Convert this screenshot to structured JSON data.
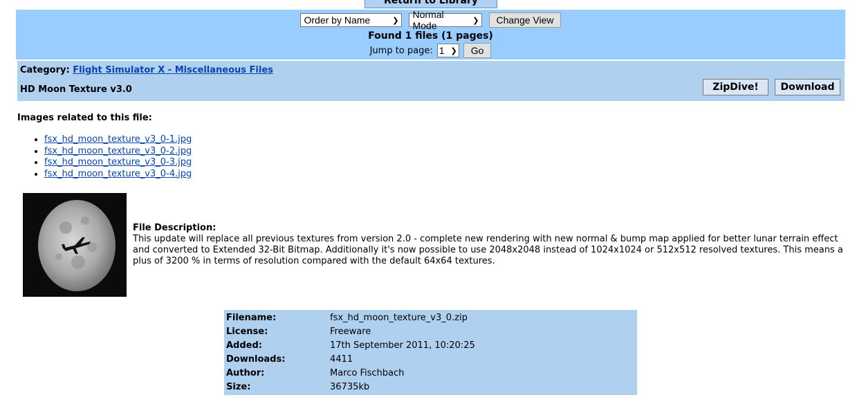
{
  "nav": {
    "return_label": "Return to Library"
  },
  "controls": {
    "order_select": "Order by Name",
    "mode_select": "Normal Mode",
    "change_view_label": "Change View",
    "found_text": "Found 1 files (1 pages)",
    "jump_label": "Jump to page:",
    "page_select": "1",
    "go_label": "Go"
  },
  "category": {
    "label": "Category:",
    "link_text": "Flight Simulator X - Miscellaneous Files",
    "file_title": "HD Moon Texture v3.0",
    "zipdive_label": "ZipDive!",
    "download_label": "Download"
  },
  "images": {
    "heading": "Images related to this file:",
    "files": [
      "fsx_hd_moon_texture_v3_0-1.jpg",
      "fsx_hd_moon_texture_v3_0-2.jpg",
      "fsx_hd_moon_texture_v3_0-3.jpg",
      "fsx_hd_moon_texture_v3_0-4.jpg"
    ]
  },
  "description": {
    "title": "File Description:",
    "text": "This update will replace all previous textures from version 2.0 - complete new rendering with new normal & bump map applied for better lunar terrain effect and converted to Extended 32-Bit Bitmap. Additionally it's now possible to use 2048x2048 instead of 1024x1024 or 512x512 resolved textures. This means a plus of 3200 % in terms of resolution compared with the default 64x64 textures."
  },
  "info": [
    {
      "label": "Filename:",
      "value": "fsx_hd_moon_texture_v3_0.zip"
    },
    {
      "label": "License:",
      "value": "Freeware"
    },
    {
      "label": "Added:",
      "value": "17th September 2011, 10:20:25"
    },
    {
      "label": "Downloads:",
      "value": "4411"
    },
    {
      "label": "Author:",
      "value": "Marco Fischbach"
    },
    {
      "label": "Size:",
      "value": "36735kb"
    }
  ],
  "colors": {
    "top_bar": "#99ccff",
    "category_bar": "#b0d0f0",
    "link": "#0645ad"
  }
}
